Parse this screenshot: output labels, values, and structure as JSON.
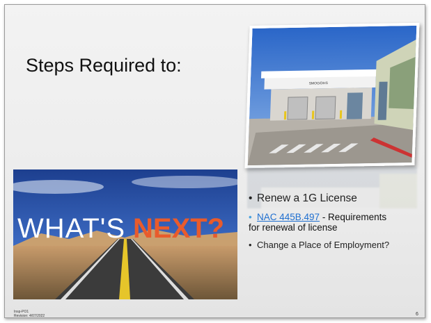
{
  "slide": {
    "title": "Steps Required to:",
    "bullets": {
      "b1": "Renew a 1G License",
      "b2_link": "NAC 445B.497",
      "b2_rest": " - Requirements",
      "b2_rest2": "for renewal of license",
      "b3": "Change a Place of Employment?"
    },
    "image_text": {
      "whats": "WHAT'S",
      "next": "NEXT?",
      "building_sign": "SMOG/DHS"
    },
    "footer": {
      "line1": "Insp-PO1",
      "line2": "Revision: 4/07/2022"
    },
    "page_number": "6"
  },
  "colors": {
    "link": "#1f6fd0",
    "bullet_accent": "#4aa3df",
    "next_text": "#e85b2c"
  }
}
